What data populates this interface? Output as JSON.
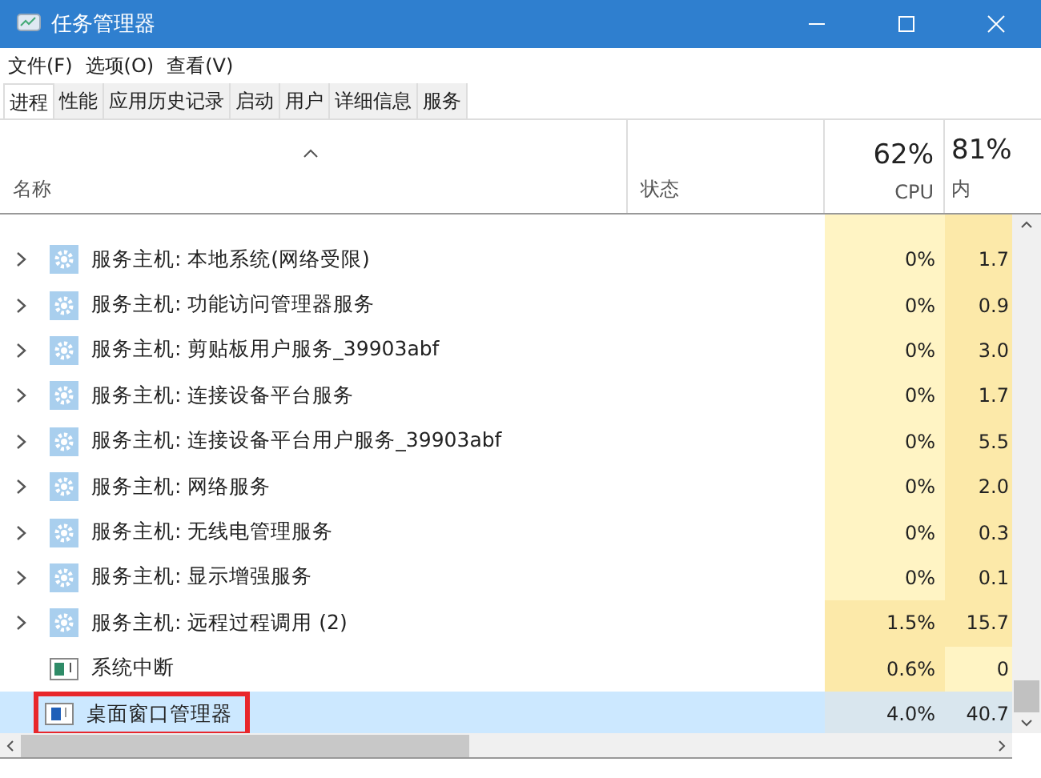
{
  "window": {
    "title": "任务管理器"
  },
  "menu": [
    "文件(F)",
    "选项(O)",
    "查看(V)"
  ],
  "tabs": [
    {
      "label": "进程",
      "selected": true
    },
    {
      "label": "性能",
      "selected": false
    },
    {
      "label": "应用历史记录",
      "selected": false
    },
    {
      "label": "启动",
      "selected": false
    },
    {
      "label": "用户",
      "selected": false
    },
    {
      "label": "详细信息",
      "selected": false
    },
    {
      "label": "服务",
      "selected": false
    }
  ],
  "columns": {
    "name": "名称",
    "status": "状态",
    "cpu": {
      "total": "62%",
      "label": "CPU"
    },
    "memory": {
      "total": "81%",
      "label": "内"
    }
  },
  "rows": [
    {
      "kind": "service",
      "expandable": true,
      "name": "服务主机: 本地系统(网络受限)",
      "cpu": {
        "text": "0%",
        "color": "#fff4c4"
      },
      "memory": {
        "text": "1.7",
        "color": "#fce9a9"
      },
      "selected": false,
      "outlined": false
    },
    {
      "kind": "service",
      "expandable": true,
      "name": "服务主机: 功能访问管理器服务",
      "cpu": {
        "text": "0%",
        "color": "#fff4c4"
      },
      "memory": {
        "text": "0.9",
        "color": "#fce9a9"
      },
      "selected": false,
      "outlined": false
    },
    {
      "kind": "service",
      "expandable": true,
      "name": "服务主机: 剪贴板用户服务_39903abf",
      "cpu": {
        "text": "0%",
        "color": "#fff4c4"
      },
      "memory": {
        "text": "3.0",
        "color": "#fce9a9"
      },
      "selected": false,
      "outlined": false
    },
    {
      "kind": "service",
      "expandable": true,
      "name": "服务主机: 连接设备平台服务",
      "cpu": {
        "text": "0%",
        "color": "#fff4c4"
      },
      "memory": {
        "text": "1.7",
        "color": "#fce9a9"
      },
      "selected": false,
      "outlined": false
    },
    {
      "kind": "service",
      "expandable": true,
      "name": "服务主机: 连接设备平台用户服务_39903abf",
      "cpu": {
        "text": "0%",
        "color": "#fff4c4"
      },
      "memory": {
        "text": "5.5",
        "color": "#fce9a9"
      },
      "selected": false,
      "outlined": false
    },
    {
      "kind": "service",
      "expandable": true,
      "name": "服务主机: 网络服务",
      "cpu": {
        "text": "0%",
        "color": "#fff4c4"
      },
      "memory": {
        "text": "2.0",
        "color": "#fce9a9"
      },
      "selected": false,
      "outlined": false
    },
    {
      "kind": "service",
      "expandable": true,
      "name": "服务主机: 无线电管理服务",
      "cpu": {
        "text": "0%",
        "color": "#fff4c4"
      },
      "memory": {
        "text": "0.3",
        "color": "#fce9a9"
      },
      "selected": false,
      "outlined": false
    },
    {
      "kind": "service",
      "expandable": true,
      "name": "服务主机: 显示增强服务",
      "cpu": {
        "text": "0%",
        "color": "#fff4c4"
      },
      "memory": {
        "text": "0.1",
        "color": "#fce9a9"
      },
      "selected": false,
      "outlined": false
    },
    {
      "kind": "service",
      "expandable": true,
      "name": "服务主机: 远程过程调用 (2)",
      "cpu": {
        "text": "1.5%",
        "color": "#fce9a9"
      },
      "memory": {
        "text": "15.7",
        "color": "#fce9a9"
      },
      "selected": false,
      "outlined": false
    },
    {
      "kind": "system",
      "expandable": false,
      "name": "系统中断",
      "cpu": {
        "text": "0.6%",
        "color": "#fce9a9"
      },
      "memory": {
        "text": "0",
        "color": "#fff4c4"
      },
      "selected": false,
      "outlined": false
    },
    {
      "kind": "window",
      "expandable": false,
      "name": "桌面窗口管理器",
      "cpu": {
        "text": "4.0%",
        "color": "#d9e6ee"
      },
      "memory": {
        "text": "40.7",
        "color": "#d9e6ee"
      },
      "selected": true,
      "outlined": true
    }
  ]
}
